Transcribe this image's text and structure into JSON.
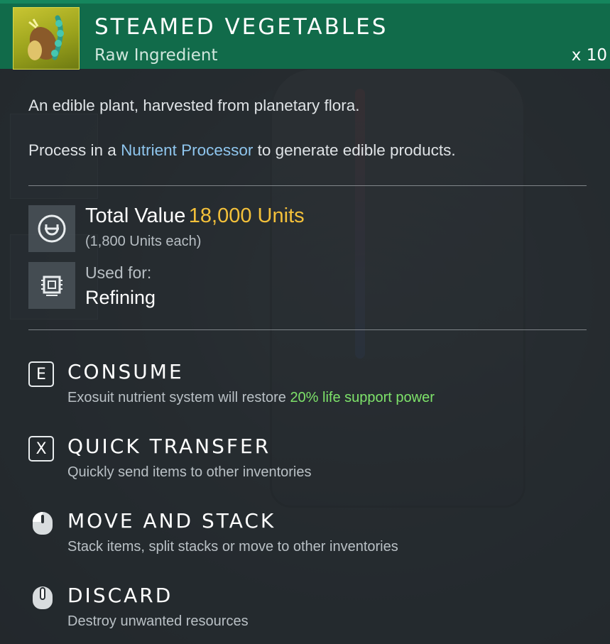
{
  "header": {
    "title": "STEAMED VEGETABLES",
    "subtitle": "Raw Ingredient",
    "quantity": "x 10"
  },
  "description": {
    "line1": "An edible plant, harvested from planetary flora.",
    "line2_prefix": "Process in a ",
    "line2_highlight": "Nutrient Processor",
    "line2_suffix": " to generate edible products."
  },
  "stats": {
    "total_value_label": "Total Value",
    "total_value_amount": "18,000 Units",
    "each_value": "(1,800 Units each)",
    "used_for_label": "Used for:",
    "used_for_value": "Refining"
  },
  "actions": [
    {
      "key": "E",
      "title": "CONSUME",
      "desc_prefix": "Exosuit nutrient system will restore ",
      "desc_highlight": "20% life support power"
    },
    {
      "key": "X",
      "title": "QUICK TRANSFER",
      "desc": "Quickly send items to other inventories"
    },
    {
      "icon": "mouse-left-icon",
      "title": "MOVE AND STACK",
      "desc": "Stack items, split stacks or move to other inventories"
    },
    {
      "icon": "mouse-middle-icon",
      "title": "DISCARD",
      "desc": "Destroy unwanted resources"
    }
  ],
  "colors": {
    "header_bg": "#116b4a",
    "value": "#f3c03a",
    "link": "#8fc6ee",
    "highlight_green": "#7ee36a"
  },
  "icons": {
    "item": "steamed-vegetables-icon",
    "units": "units-currency-icon",
    "refining": "refiner-chip-icon"
  }
}
